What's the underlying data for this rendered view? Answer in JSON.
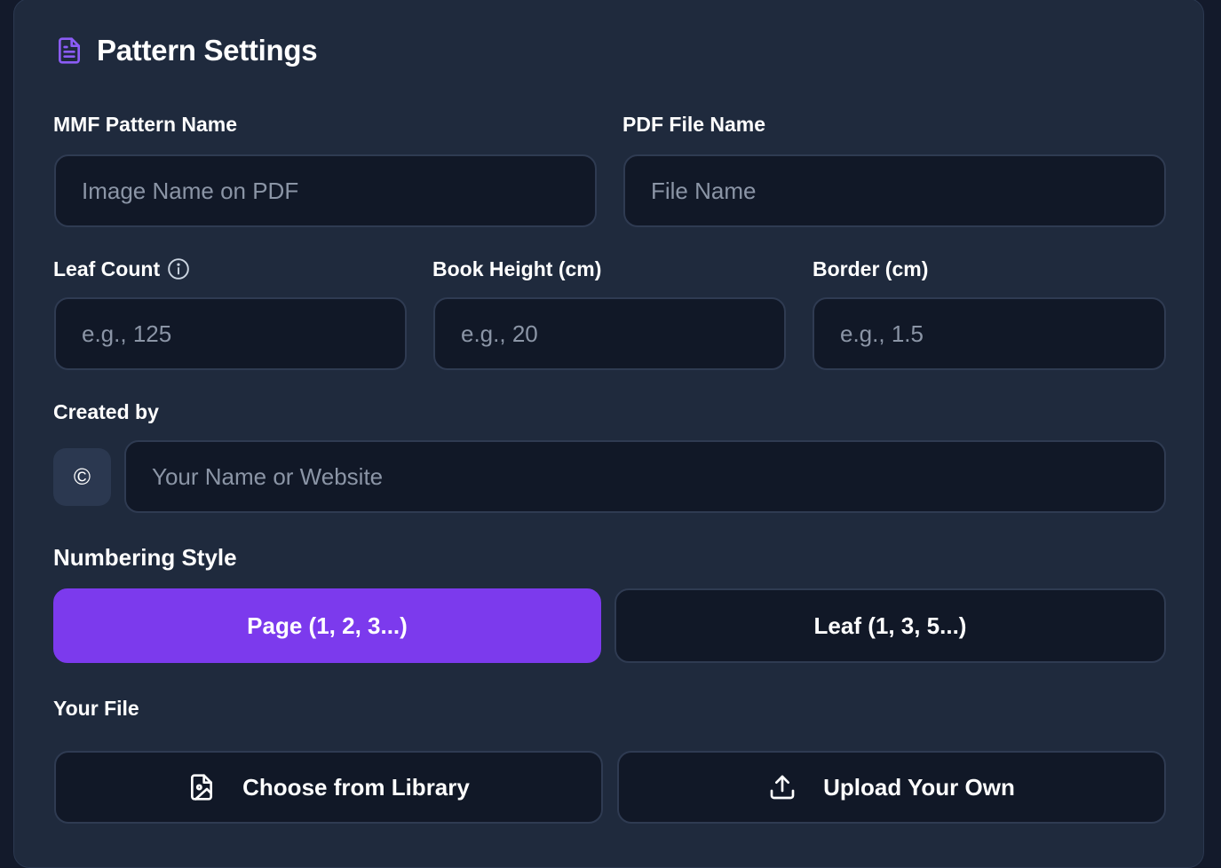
{
  "header": {
    "title": "Pattern Settings",
    "icon": "document-icon",
    "icon_color": "#8b5cf6"
  },
  "fields": {
    "pattern_name": {
      "label": "MMF Pattern Name",
      "placeholder": "Image Name on PDF",
      "value": ""
    },
    "file_name": {
      "label": "PDF File Name",
      "placeholder": "File Name",
      "value": ""
    },
    "leaf_count": {
      "label": "Leaf Count",
      "placeholder": "e.g., 125",
      "value": "",
      "info_icon": "info-icon"
    },
    "book_height": {
      "label": "Book Height (cm)",
      "placeholder": "e.g., 20",
      "value": ""
    },
    "border": {
      "label": "Border (cm)",
      "placeholder": "e.g., 1.5",
      "value": ""
    },
    "created_by": {
      "label": "Created by",
      "prefix": "©",
      "placeholder": "Your Name or Website",
      "value": ""
    }
  },
  "numbering": {
    "label": "Numbering Style",
    "options": [
      {
        "label": "Page (1, 2, 3...)",
        "selected": true
      },
      {
        "label": "Leaf (1, 3, 5...)",
        "selected": false
      }
    ]
  },
  "file": {
    "label": "Your File",
    "library_button": {
      "label": "Choose from Library",
      "icon": "image-file-icon"
    },
    "upload_button": {
      "label": "Upload Your Own",
      "icon": "upload-icon"
    }
  },
  "colors": {
    "accent": "#7c3aed",
    "card_background": "#1f2a3d",
    "input_background": "#111827"
  }
}
